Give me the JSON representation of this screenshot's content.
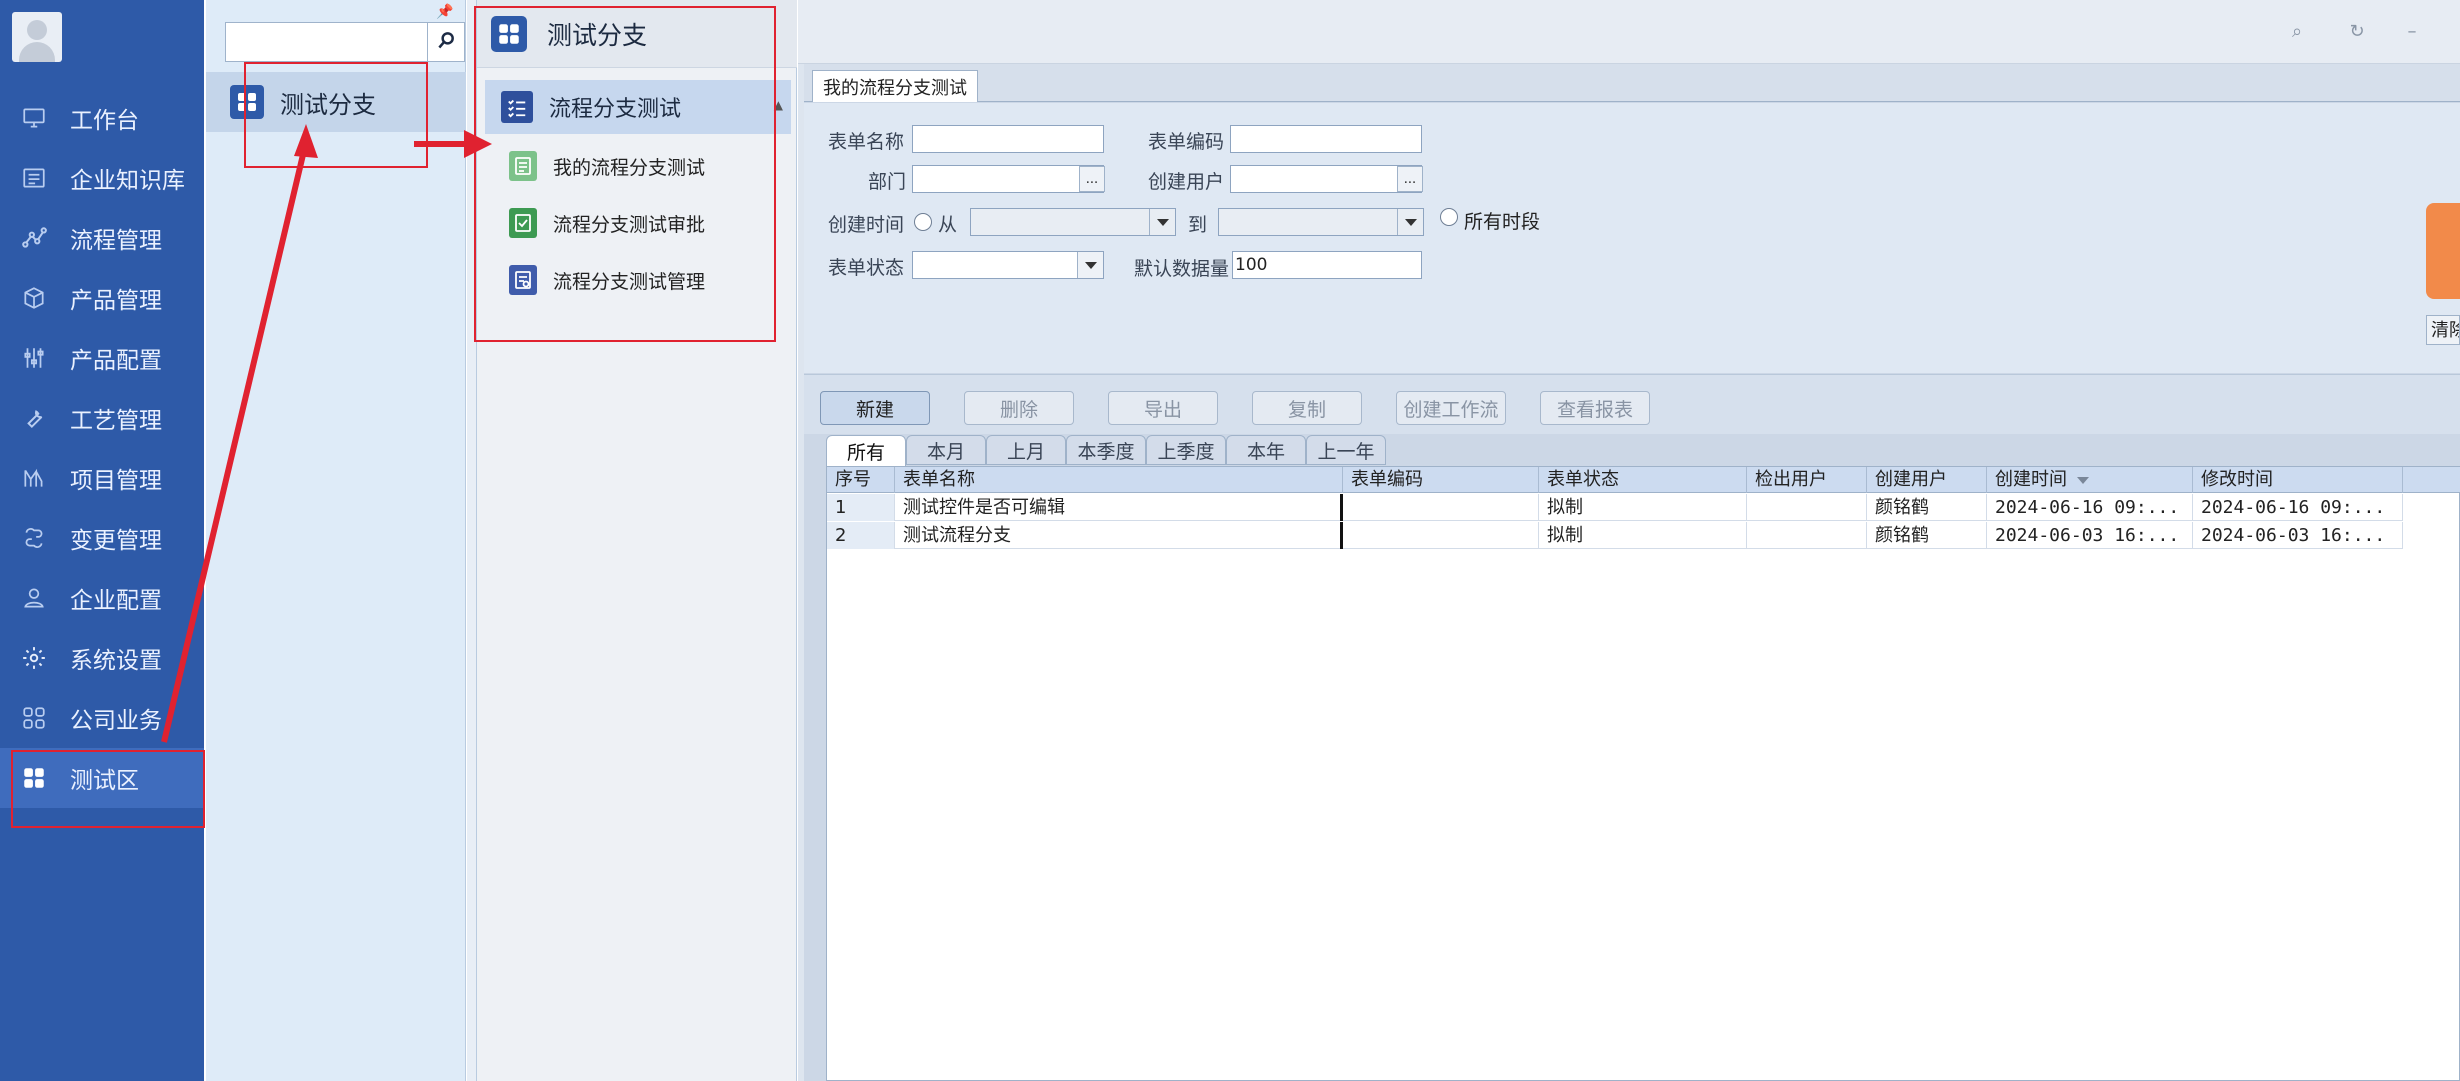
{
  "nav": {
    "items": [
      {
        "label": "工作台",
        "icon": "monitor-icon"
      },
      {
        "label": "企业知识库",
        "icon": "document-list-icon"
      },
      {
        "label": "流程管理",
        "icon": "flow-icon"
      },
      {
        "label": "产品管理",
        "icon": "box-icon"
      },
      {
        "label": "产品配置",
        "icon": "sliders-icon"
      },
      {
        "label": "工艺管理",
        "icon": "wrench-icon"
      },
      {
        "label": "项目管理",
        "icon": "project-icon"
      },
      {
        "label": "变更管理",
        "icon": "change-icon"
      },
      {
        "label": "企业配置",
        "icon": "person-icon"
      },
      {
        "label": "系统设置",
        "icon": "gear-icon"
      },
      {
        "label": "公司业务",
        "icon": "grid-icon"
      },
      {
        "label": "测试区",
        "icon": "grid-solid-icon"
      }
    ]
  },
  "col2": {
    "search_value": "",
    "item_label": "测试分支"
  },
  "module": {
    "title": "测试分支",
    "group_label": "流程分支测试",
    "sub_items": [
      {
        "label": "我的流程分支测试",
        "icon": "form-green-icon"
      },
      {
        "label": "流程分支测试审批",
        "icon": "approve-green-icon"
      },
      {
        "label": "流程分支测试管理",
        "icon": "manage-blue-icon"
      }
    ]
  },
  "main": {
    "tab_label": "我的流程分支测试",
    "filters": {
      "form_name_label": "表单名称",
      "form_code_label": "表单编码",
      "dept_label": "部门",
      "creator_label": "创建用户",
      "created_time_label": "创建时间",
      "from_label": "从",
      "to_label": "到",
      "all_periods_label": "所有时段",
      "status_label": "表单状态",
      "default_count_label": "默认数据量",
      "default_count_value": "100",
      "dots": "...",
      "clear_label": "清除"
    },
    "toolbar": [
      "新建",
      "删除",
      "导出",
      "复制",
      "创建工作流",
      "查看报表"
    ],
    "period_tabs": [
      "所有",
      "本月",
      "上月",
      "本季度",
      "上季度",
      "本年",
      "上一年"
    ],
    "grid": {
      "columns": [
        "序号",
        "表单名称",
        "表单编码",
        "表单状态",
        "检出用户",
        "创建用户",
        "创建时间",
        "修改时间"
      ],
      "rows": [
        [
          "1",
          "测试控件是否可编辑",
          "",
          "拟制",
          "",
          "颜铭鹤",
          "2024-06-16 09:...",
          "2024-06-16 09:..."
        ],
        [
          "2",
          "测试流程分支",
          "",
          "拟制",
          "",
          "颜铭鹤",
          "2024-06-03 16:...",
          "2024-06-03 16:..."
        ]
      ]
    }
  },
  "colors": {
    "nav_bg": "#2e5aa8",
    "annotation_red": "#e02230",
    "accent_orange": "#f28a4a"
  }
}
